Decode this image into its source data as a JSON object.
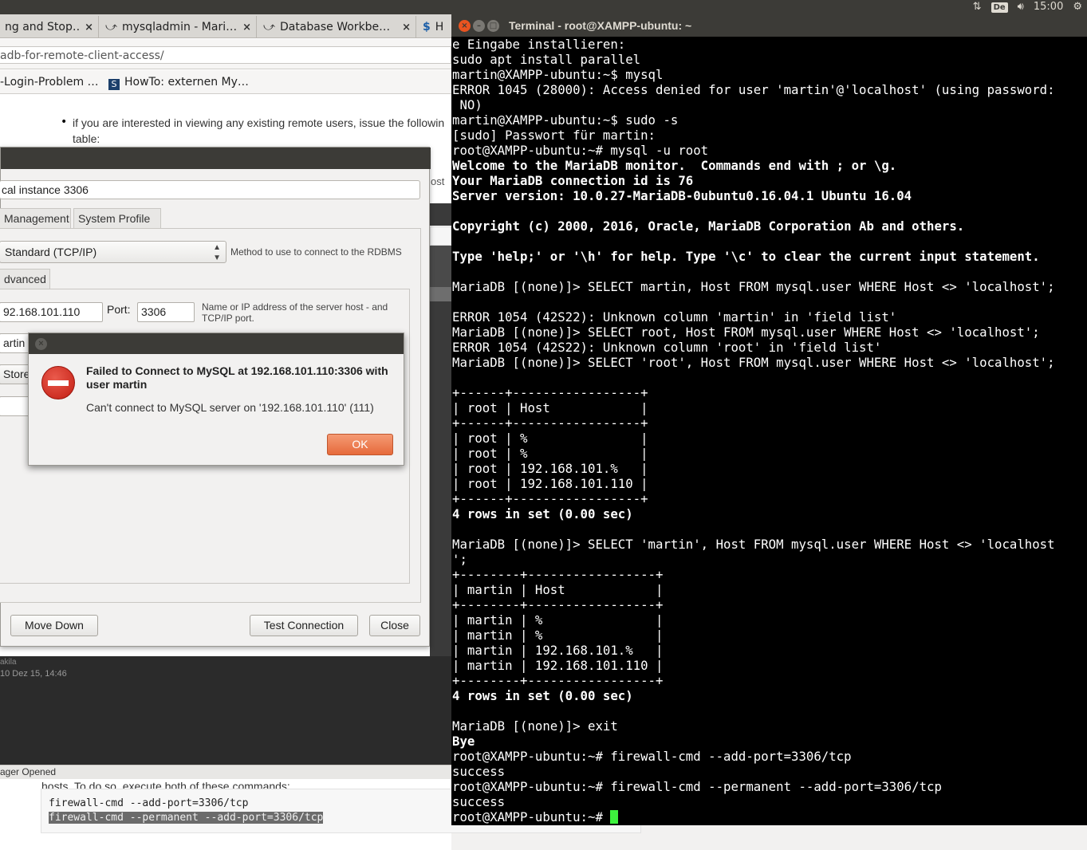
{
  "system_bar": {
    "keyboard_layout": "De",
    "time": "15:00"
  },
  "browser": {
    "tabs": [
      {
        "label": "ng and Stop…",
        "close": "×"
      },
      {
        "label": "mysqladmin - Mari…",
        "close": "×"
      },
      {
        "label": "Database Workbe…",
        "close": "×"
      },
      {
        "label": "H",
        "close": ""
      }
    ],
    "url": "adb-for-remote-client-access/",
    "bookmarks": [
      {
        "label": "-Login-Problem …"
      },
      {
        "label": "HowTo: externen My…"
      }
    ],
    "page": {
      "bullet_line1": "if you are interested in viewing any existing remote users, issue the followin",
      "bullet_line2": "table:",
      "hosts_text": "hosts. To do so, execute both of these commands:",
      "code_line1": "firewall-cmd --add-port=3306/tcp",
      "code_line2": "firewall-cmd --permanent --add-port=3306/tcp",
      "fragment_ost": "ost"
    }
  },
  "workbench": {
    "connection_name": "cal instance 3306",
    "tabs": [
      "Management",
      "System Profile"
    ],
    "method_value": "Standard (TCP/IP)",
    "method_hint": "Method to use to connect to the RDBMS",
    "subtab": "dvanced",
    "hostname_value": "92.168.101.110",
    "port_label": "Port:",
    "port_value": "3306",
    "host_hint": "Name or IP address of the server host - and TCP/IP port.",
    "username_value": "artin",
    "store_label": "Store",
    "buttons": {
      "move_down": "Move Down",
      "test_connection": "Test Connection",
      "close": "Close"
    },
    "bg_conn_name": "akila",
    "bg_conn_date": "10 Dez 15, 14:46",
    "status": "ager Opened"
  },
  "error_dialog": {
    "heading": "Failed to Connect to MySQL at 192.168.101.110:3306 with user martin",
    "message": "Can't connect to MySQL server on '192.168.101.110' (111)",
    "ok_label": "OK",
    "close_symbol": "×"
  },
  "terminal": {
    "title": "Terminal - root@XAMPP-ubuntu: ~",
    "lines": [
      {
        "text": "e Eingabe installieren:",
        "bold": false
      },
      {
        "text": "sudo apt install parallel",
        "bold": false
      },
      {
        "text": "martin@XAMPP-ubuntu:~$ mysql",
        "bold": false
      },
      {
        "text": "ERROR 1045 (28000): Access denied for user 'martin'@'localhost' (using password:",
        "bold": false
      },
      {
        "text": " NO)",
        "bold": false
      },
      {
        "text": "martin@XAMPP-ubuntu:~$ sudo -s",
        "bold": false
      },
      {
        "text": "[sudo] Passwort für martin:",
        "bold": false
      },
      {
        "text": "root@XAMPP-ubuntu:~# mysql -u root",
        "bold": false
      },
      {
        "text": "Welcome to the MariaDB monitor.  Commands end with ; or \\g.",
        "bold": true
      },
      {
        "text": "Your MariaDB connection id is 76",
        "bold": true
      },
      {
        "text": "Server version: 10.0.27-MariaDB-0ubuntu0.16.04.1 Ubuntu 16.04",
        "bold": true
      },
      {
        "text": "",
        "bold": false
      },
      {
        "text": "Copyright (c) 2000, 2016, Oracle, MariaDB Corporation Ab and others.",
        "bold": true
      },
      {
        "text": "",
        "bold": false
      },
      {
        "text": "Type 'help;' or '\\h' for help. Type '\\c' to clear the current input statement.",
        "bold": true
      },
      {
        "text": "",
        "bold": false
      },
      {
        "text": "MariaDB [(none)]> SELECT martin, Host FROM mysql.user WHERE Host <> 'localhost';",
        "bold": false
      },
      {
        "text": "",
        "bold": false
      },
      {
        "text": "ERROR 1054 (42S22): Unknown column 'martin' in 'field list'",
        "bold": false
      },
      {
        "text": "MariaDB [(none)]> SELECT root, Host FROM mysql.user WHERE Host <> 'localhost';",
        "bold": false
      },
      {
        "text": "ERROR 1054 (42S22): Unknown column 'root' in 'field list'",
        "bold": false
      },
      {
        "text": "MariaDB [(none)]> SELECT 'root', Host FROM mysql.user WHERE Host <> 'localhost';",
        "bold": false
      },
      {
        "text": "",
        "bold": false
      },
      {
        "text": "+------+-----------------+",
        "bold": false
      },
      {
        "text": "| root | Host            |",
        "bold": false
      },
      {
        "text": "+------+-----------------+",
        "bold": false
      },
      {
        "text": "| root | %               |",
        "bold": false
      },
      {
        "text": "| root | %               |",
        "bold": false
      },
      {
        "text": "| root | 192.168.101.%   |",
        "bold": false
      },
      {
        "text": "| root | 192.168.101.110 |",
        "bold": false
      },
      {
        "text": "+------+-----------------+",
        "bold": false
      },
      {
        "text": "4 rows in set (0.00 sec)",
        "bold": true
      },
      {
        "text": "",
        "bold": false
      },
      {
        "text": "MariaDB [(none)]> SELECT 'martin', Host FROM mysql.user WHERE Host <> 'localhost",
        "bold": false
      },
      {
        "text": "';",
        "bold": false
      },
      {
        "text": "+--------+-----------------+",
        "bold": false
      },
      {
        "text": "| martin | Host            |",
        "bold": false
      },
      {
        "text": "+--------+-----------------+",
        "bold": false
      },
      {
        "text": "| martin | %               |",
        "bold": false
      },
      {
        "text": "| martin | %               |",
        "bold": false
      },
      {
        "text": "| martin | 192.168.101.%   |",
        "bold": false
      },
      {
        "text": "| martin | 192.168.101.110 |",
        "bold": false
      },
      {
        "text": "+--------+-----------------+",
        "bold": false
      },
      {
        "text": "4 rows in set (0.00 sec)",
        "bold": true
      },
      {
        "text": "",
        "bold": false
      },
      {
        "text": "MariaDB [(none)]> exit",
        "bold": false
      },
      {
        "text": "Bye",
        "bold": true
      },
      {
        "text": "root@XAMPP-ubuntu:~# firewall-cmd --add-port=3306/tcp",
        "bold": false
      },
      {
        "text": "success",
        "bold": false
      },
      {
        "text": "root@XAMPP-ubuntu:~# firewall-cmd --permanent --add-port=3306/tcp",
        "bold": false
      },
      {
        "text": "success",
        "bold": false
      }
    ],
    "prompt": "root@XAMPP-ubuntu:~# "
  }
}
